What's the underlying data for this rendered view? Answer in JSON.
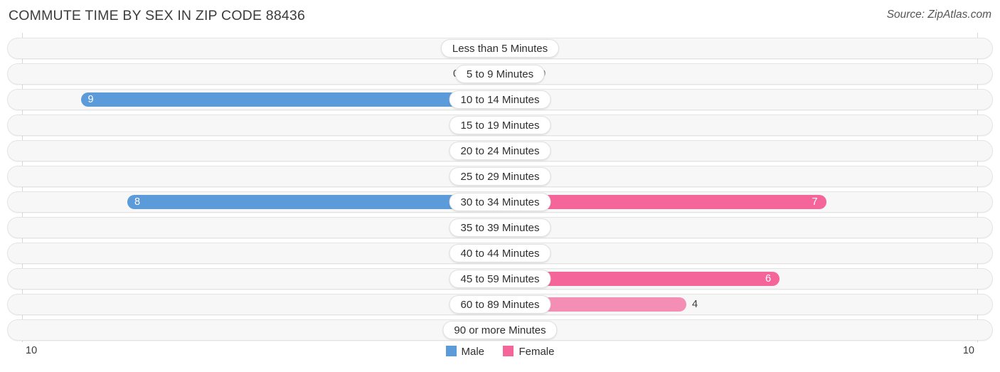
{
  "header": {
    "title": "COMMUTE TIME BY SEX IN ZIP CODE 88436",
    "source": "Source: ZipAtlas.com"
  },
  "legend": {
    "male_label": "Male",
    "female_label": "Female",
    "male_color": "#5b9bd9",
    "female_color": "#f4659a"
  },
  "axis": {
    "left_tick": "10",
    "right_tick": "10"
  },
  "chart_data": {
    "type": "bar",
    "subtype": "diverging-bar",
    "title": "COMMUTE TIME BY SEX IN ZIP CODE 88436",
    "xlabel": "",
    "ylabel": "",
    "xlim": [
      10,
      10
    ],
    "axis_left_max": 10,
    "axis_right_max": 10,
    "grid": false,
    "legend_position": "bottom-center",
    "categories": [
      "Less than 5 Minutes",
      "5 to 9 Minutes",
      "10 to 14 Minutes",
      "15 to 19 Minutes",
      "20 to 24 Minutes",
      "25 to 29 Minutes",
      "30 to 34 Minutes",
      "35 to 39 Minutes",
      "40 to 44 Minutes",
      "45 to 59 Minutes",
      "60 to 89 Minutes",
      "90 or more Minutes"
    ],
    "series": [
      {
        "name": "Male",
        "color": "#5b9bd9",
        "direction": "left",
        "values": [
          0,
          0,
          9,
          0,
          0,
          0,
          8,
          0,
          0,
          0,
          0,
          0
        ],
        "labels": [
          "0",
          "0",
          "9",
          "0",
          "0",
          "0",
          "8",
          "0",
          "0",
          "0",
          "0",
          "0"
        ]
      },
      {
        "name": "Female",
        "color": "#f4659a",
        "direction": "right",
        "values": [
          0,
          0,
          0,
          0,
          0,
          0,
          7,
          0,
          0,
          6,
          4,
          0
        ],
        "labels": [
          "0",
          "0",
          "0",
          "0",
          "0",
          "0",
          "7",
          "0",
          "0",
          "6",
          "4",
          "0"
        ]
      }
    ]
  }
}
